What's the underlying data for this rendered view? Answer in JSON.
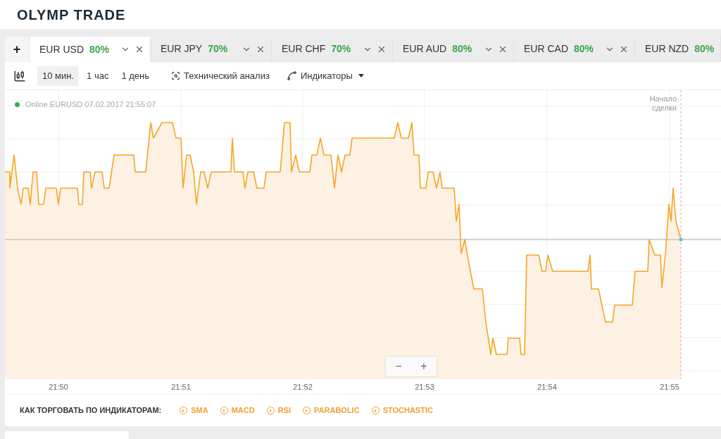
{
  "logo": {
    "text": "OLYMP TRADE"
  },
  "add_tab": "+",
  "tabs": [
    {
      "pair": "EUR USD",
      "payout": "80%",
      "selected": true,
      "controls": true
    },
    {
      "pair": "EUR JPY",
      "payout": "70%",
      "selected": false,
      "controls": true
    },
    {
      "pair": "EUR CHF",
      "payout": "70%",
      "selected": false,
      "controls": true
    },
    {
      "pair": "EUR AUD",
      "payout": "80%",
      "selected": false,
      "controls": true
    },
    {
      "pair": "EUR CAD",
      "payout": "80%",
      "selected": false,
      "controls": true
    },
    {
      "pair": "EUR NZD",
      "payout": "80%",
      "selected": false,
      "controls": false
    }
  ],
  "toolbar": {
    "timeframes": [
      {
        "label": "10 мин.",
        "selected": true
      },
      {
        "label": "1 час",
        "selected": false
      },
      {
        "label": "1 день",
        "selected": false
      }
    ],
    "analysis": "Технический анализ",
    "indicators": "Индикаторы"
  },
  "chart": {
    "status": "Online EURUSD 07.02.2017 21:55:07",
    "online": true,
    "deal_marker": "Начало сделки",
    "x_labels": [
      "21:50",
      "21:51",
      "21:52",
      "21:53",
      "21:54",
      "21:55"
    ]
  },
  "zoom": {
    "minus": "−",
    "plus": "+"
  },
  "guides": {
    "label": "КАК ТОРГОВАТЬ ПО ИНДИКАТОРАМ:",
    "links": [
      "SMA",
      "MACD",
      "RSI",
      "PARABOLIC",
      "STOCHASTIC"
    ]
  }
}
